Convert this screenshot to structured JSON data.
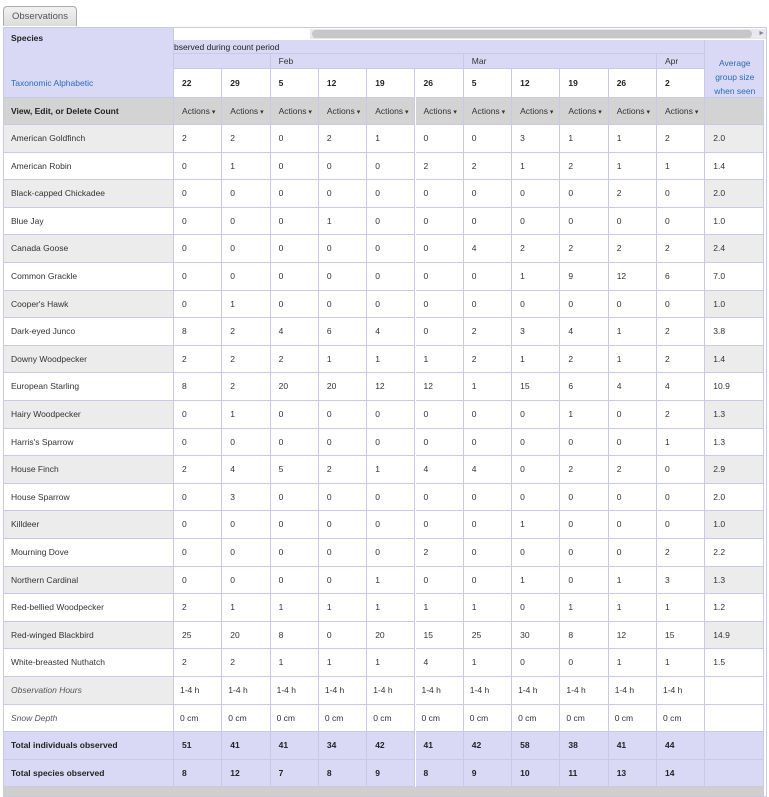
{
  "tab": {
    "label": "Observations"
  },
  "header": {
    "species_label": "Species",
    "observed_caption": "bserved during count period",
    "taxonomic_link": "Taxonomic Alphabetic",
    "avg_label": "Average group size when seen",
    "view_edit_label": "View, Edit, or Delete Count",
    "actions_label": "Actions"
  },
  "months": [
    {
      "label": "",
      "span": 2
    },
    {
      "label": "Feb",
      "span": 4
    },
    {
      "label": "Mar",
      "span": 4
    },
    {
      "label": "Apr",
      "span": 1
    }
  ],
  "days": [
    "22",
    "29",
    "5",
    "12",
    "19",
    "26",
    "5",
    "12",
    "19",
    "26",
    "2"
  ],
  "species": [
    {
      "name": "American Goldfinch",
      "counts": [
        "2",
        "2",
        "0",
        "2",
        "1",
        "0",
        "0",
        "3",
        "1",
        "1",
        "2"
      ],
      "avg": "2.0"
    },
    {
      "name": "American Robin",
      "counts": [
        "0",
        "1",
        "0",
        "0",
        "0",
        "2",
        "2",
        "1",
        "2",
        "1",
        "1"
      ],
      "avg": "1.4"
    },
    {
      "name": "Black-capped Chickadee",
      "counts": [
        "0",
        "0",
        "0",
        "0",
        "0",
        "0",
        "0",
        "0",
        "0",
        "2",
        "0"
      ],
      "avg": "2.0"
    },
    {
      "name": "Blue Jay",
      "counts": [
        "0",
        "0",
        "0",
        "1",
        "0",
        "0",
        "0",
        "0",
        "0",
        "0",
        "0"
      ],
      "avg": "1.0"
    },
    {
      "name": "Canada Goose",
      "counts": [
        "0",
        "0",
        "0",
        "0",
        "0",
        "0",
        "4",
        "2",
        "2",
        "2",
        "2"
      ],
      "avg": "2.4"
    },
    {
      "name": "Common Grackle",
      "counts": [
        "0",
        "0",
        "0",
        "0",
        "0",
        "0",
        "0",
        "1",
        "9",
        "12",
        "6"
      ],
      "avg": "7.0"
    },
    {
      "name": "Cooper's Hawk",
      "counts": [
        "0",
        "1",
        "0",
        "0",
        "0",
        "0",
        "0",
        "0",
        "0",
        "0",
        "0"
      ],
      "avg": "1.0"
    },
    {
      "name": "Dark-eyed Junco",
      "counts": [
        "8",
        "2",
        "4",
        "6",
        "4",
        "0",
        "2",
        "3",
        "4",
        "1",
        "2"
      ],
      "avg": "3.8"
    },
    {
      "name": "Downy Woodpecker",
      "counts": [
        "2",
        "2",
        "2",
        "1",
        "1",
        "1",
        "2",
        "1",
        "2",
        "1",
        "2"
      ],
      "avg": "1.4"
    },
    {
      "name": "European Starling",
      "counts": [
        "8",
        "2",
        "20",
        "20",
        "12",
        "12",
        "1",
        "15",
        "6",
        "4",
        "4"
      ],
      "avg": "10.9"
    },
    {
      "name": "Hairy Woodpecker",
      "counts": [
        "0",
        "1",
        "0",
        "0",
        "0",
        "0",
        "0",
        "0",
        "1",
        "0",
        "2"
      ],
      "avg": "1.3"
    },
    {
      "name": "Harris's Sparrow",
      "counts": [
        "0",
        "0",
        "0",
        "0",
        "0",
        "0",
        "0",
        "0",
        "0",
        "0",
        "1"
      ],
      "avg": "1.3"
    },
    {
      "name": "House Finch",
      "counts": [
        "2",
        "4",
        "5",
        "2",
        "1",
        "4",
        "4",
        "0",
        "2",
        "2",
        "0"
      ],
      "avg": "2.9"
    },
    {
      "name": "House Sparrow",
      "counts": [
        "0",
        "3",
        "0",
        "0",
        "0",
        "0",
        "0",
        "0",
        "0",
        "0",
        "0"
      ],
      "avg": "2.0"
    },
    {
      "name": "Killdeer",
      "counts": [
        "0",
        "0",
        "0",
        "0",
        "0",
        "0",
        "0",
        "1",
        "0",
        "0",
        "0"
      ],
      "avg": "1.0"
    },
    {
      "name": "Mourning Dove",
      "counts": [
        "0",
        "0",
        "0",
        "0",
        "0",
        "2",
        "0",
        "0",
        "0",
        "0",
        "2"
      ],
      "avg": "2.2"
    },
    {
      "name": "Northern Cardinal",
      "counts": [
        "0",
        "0",
        "0",
        "0",
        "1",
        "0",
        "0",
        "1",
        "0",
        "1",
        "3"
      ],
      "avg": "1.3"
    },
    {
      "name": "Red-bellied Woodpecker",
      "counts": [
        "2",
        "1",
        "1",
        "1",
        "1",
        "1",
        "1",
        "0",
        "1",
        "1",
        "1"
      ],
      "avg": "1.2"
    },
    {
      "name": "Red-winged Blackbird",
      "counts": [
        "25",
        "20",
        "8",
        "0",
        "20",
        "15",
        "25",
        "30",
        "8",
        "12",
        "15"
      ],
      "avg": "14.9"
    },
    {
      "name": "White-breasted Nuthatch",
      "counts": [
        "2",
        "2",
        "1",
        "1",
        "1",
        "4",
        "1",
        "0",
        "0",
        "1",
        "1"
      ],
      "avg": "1.5"
    }
  ],
  "observation_hours": {
    "label": "Observation Hours",
    "values": [
      "1-4 h",
      "1-4 h",
      "1-4 h",
      "1-4 h",
      "1-4 h",
      "1-4 h",
      "1-4 h",
      "1-4 h",
      "1-4 h",
      "1-4 h",
      "1-4 h"
    ]
  },
  "snow_depth": {
    "label": "Snow Depth",
    "values": [
      "0 cm",
      "0 cm",
      "0 cm",
      "0 cm",
      "0 cm",
      "0 cm",
      "0 cm",
      "0 cm",
      "0 cm",
      "0 cm",
      "0 cm"
    ]
  },
  "totals": [
    {
      "label": "Total individuals observed",
      "values": [
        "51",
        "41",
        "41",
        "34",
        "42",
        "41",
        "42",
        "58",
        "38",
        "41",
        "44"
      ]
    },
    {
      "label": "Total species observed",
      "values": [
        "8",
        "12",
        "7",
        "8",
        "9",
        "8",
        "9",
        "10",
        "11",
        "13",
        "14"
      ]
    }
  ],
  "colors": {
    "header_bg": "#d9d9f6",
    "actions_bg": "#d3d3d3",
    "row_alt": "#ececec",
    "row_plain": "#ffffff",
    "totals_bg": "#d9d9f6",
    "grid_line": "#c8c8e8",
    "link": "#2a6bb5"
  }
}
